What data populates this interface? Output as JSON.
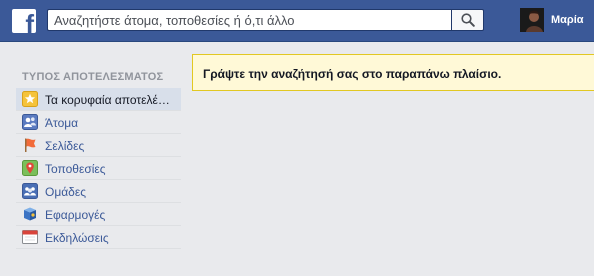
{
  "header": {
    "logo_letter": "f",
    "search_placeholder": "Αναζητήστε άτομα, τοποθεσίες ή ό,τι άλλο",
    "profile_name": "Μαρία",
    "brand_color": "#3b5998"
  },
  "sidebar": {
    "heading": "ΤΥΠΟΣ ΑΠΟΤΕΛΕΣΜΑΤΟΣ",
    "items": [
      {
        "label": "Τα κορυφαία αποτελέσματα",
        "icon": "star-icon",
        "selected": true
      },
      {
        "label": "Άτομα",
        "icon": "people-icon"
      },
      {
        "label": "Σελίδες",
        "icon": "flag-icon"
      },
      {
        "label": "Τοποθεσίες",
        "icon": "map-pin-icon"
      },
      {
        "label": "Ομάδες",
        "icon": "groups-icon"
      },
      {
        "label": "Εφαρμογές",
        "icon": "apps-icon"
      },
      {
        "label": "Εκδηλώσεις",
        "icon": "calendar-icon"
      }
    ]
  },
  "main": {
    "notice": "Γράψτε την αναζήτησή σας στο παραπάνω πλαίσιο."
  }
}
